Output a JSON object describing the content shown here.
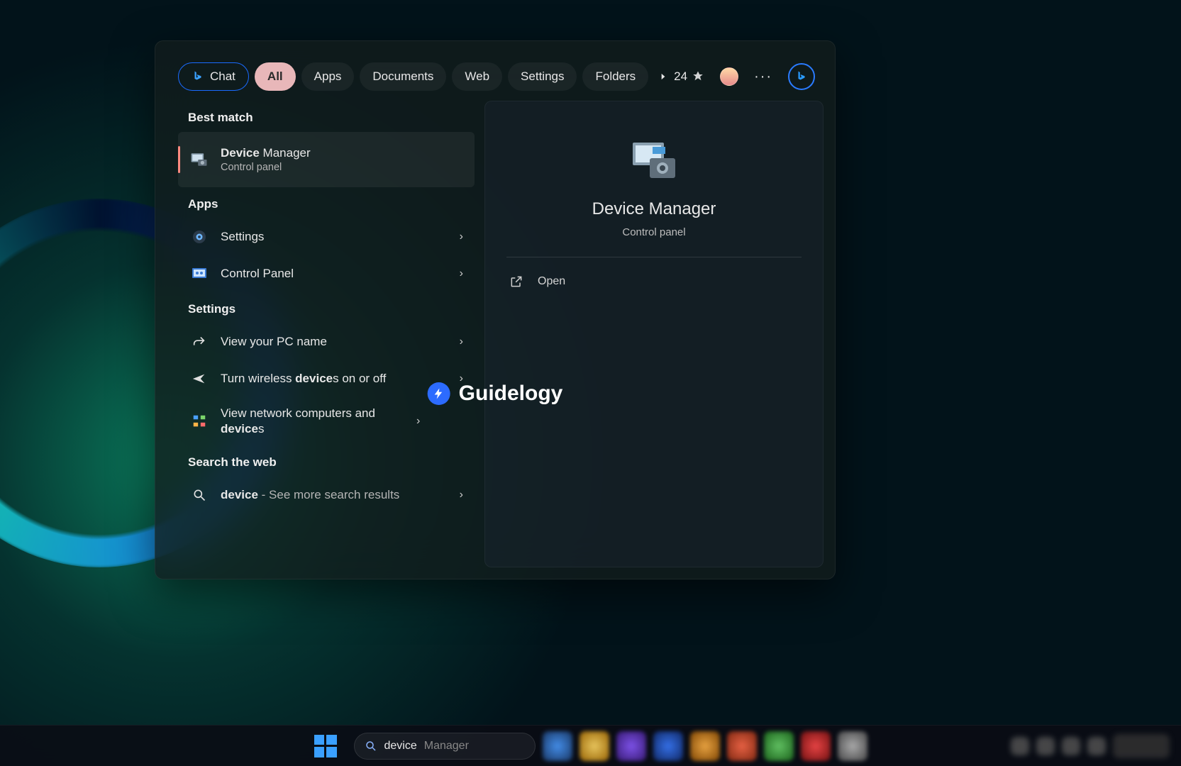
{
  "tabs": {
    "chat": "Chat",
    "all": "All",
    "apps": "Apps",
    "documents": "Documents",
    "web": "Web",
    "settings": "Settings",
    "folders": "Folders"
  },
  "rewards_points": "24",
  "sections": {
    "best_match": "Best match",
    "apps": "Apps",
    "settings": "Settings",
    "web": "Search the web"
  },
  "best_match": {
    "title_hl": "Device",
    "title_rest": " Manager",
    "subtitle": "Control panel"
  },
  "apps_results": [
    {
      "label": "Settings"
    },
    {
      "label": "Control Panel"
    }
  ],
  "settings_results": [
    {
      "label": "View your PC name"
    },
    {
      "pre": "Turn wireless ",
      "hl": "device",
      "post": "s on or off"
    },
    {
      "pre": "View network computers and ",
      "hl": "device",
      "post": "s"
    }
  ],
  "web_result": {
    "hl": "device",
    "rest": " - See more search results"
  },
  "detail": {
    "title": "Device Manager",
    "subtitle": "Control panel",
    "open": "Open"
  },
  "watermark": "Guidelogy",
  "taskbar_search": {
    "typed": "device",
    "suggest": " Manager"
  }
}
